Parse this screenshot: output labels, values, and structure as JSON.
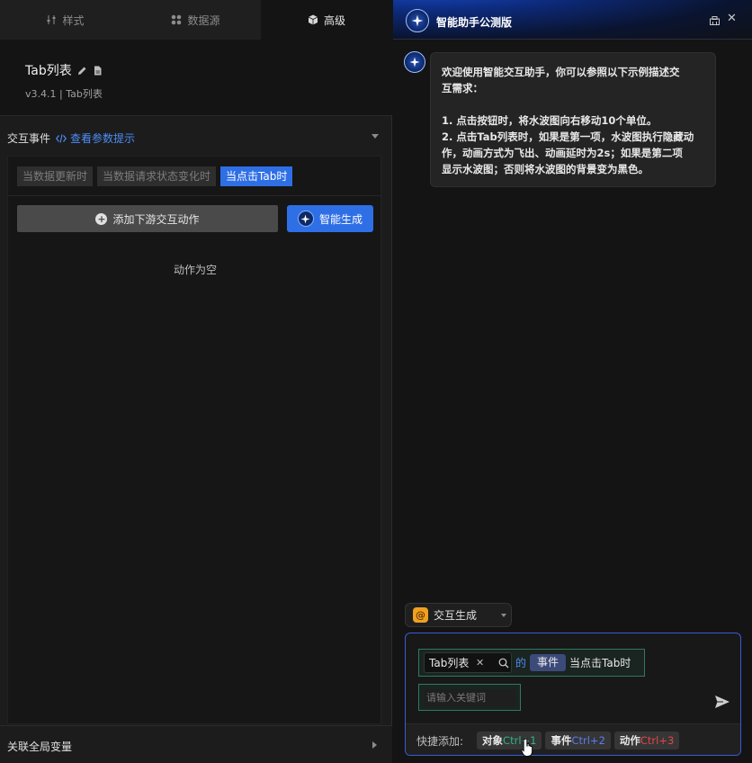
{
  "left_panel": {
    "tabs": [
      {
        "label": "样式",
        "icon": "sliders-icon",
        "active": false
      },
      {
        "label": "数据源",
        "icon": "grid-dots-icon",
        "active": false
      },
      {
        "label": "高级",
        "icon": "cube-icon",
        "active": true
      }
    ],
    "component": {
      "title": "Tab列表",
      "version": "v3.4.1 | Tab列表"
    },
    "events_section": {
      "label": "交互事件",
      "hint_link": "查看参数提示",
      "event_chips": [
        "当数据更新时",
        "当数据请求状态变化时",
        "当点击Tab时"
      ],
      "active_chip": 2,
      "add_button": "添加下游交互动作",
      "generate_button": "智能生成",
      "empty_text": "动作为空"
    },
    "global_vars_label": "关联全局变量"
  },
  "assistant": {
    "title": "智能助手公测版",
    "message_lines": [
      "欢迎使用智能交互助手，你可以参照以下示例描述交",
      "互需求：",
      "",
      "1. 点击按钮时，将水波图向右移动10个单位。",
      "2. 点击Tab列表时，如果是第一项，水波图执行隐藏动",
      "作，动画方式为飞出、动画延时为2s；如果是第二项",
      "显示水波图；否则将水波图的背景变为黑色。"
    ],
    "mode_select": {
      "icon_glyph": "@",
      "value": "交互生成"
    },
    "composer": {
      "object_token": "Tab列表",
      "connector": "的",
      "event_token": "事件",
      "event_value": "当点击Tab时",
      "keyword_placeholder": "请输入关键词"
    },
    "quick_add": {
      "label": "快捷添加:",
      "items": [
        {
          "name": "对象",
          "shortcut": "Ctrl+1"
        },
        {
          "name": "事件",
          "shortcut": "Ctrl+2"
        },
        {
          "name": "动作",
          "shortcut": "Ctrl+3"
        }
      ]
    }
  },
  "colors": {
    "accent_blue": "#2f6fe6",
    "link_blue": "#4d8ef7",
    "token_green": "#2e7a5e",
    "shortcut_green": "#2fb38a",
    "shortcut_blue": "#5b7cf0",
    "shortcut_red": "#e0454a"
  }
}
